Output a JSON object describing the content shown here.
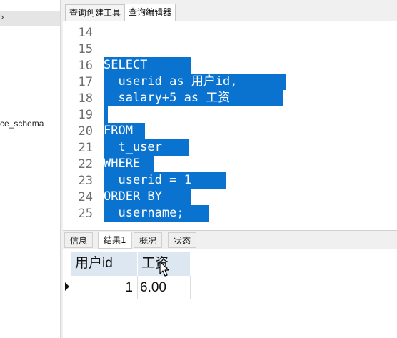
{
  "navigator": {
    "schema_item": "ce_schema",
    "selected_marker": "›"
  },
  "editor_tabs": [
    {
      "label": "查询创建工具",
      "active": false
    },
    {
      "label": "查询编辑器",
      "active": true
    }
  ],
  "editor": {
    "lines": [
      {
        "no": "14",
        "text": ""
      },
      {
        "no": "15",
        "text": ""
      },
      {
        "no": "16",
        "text": "SELECT"
      },
      {
        "no": "17",
        "text": "  userid as 用户id,"
      },
      {
        "no": "18",
        "text": "  salary+5 as 工资"
      },
      {
        "no": "19",
        "text": ""
      },
      {
        "no": "20",
        "text": "FROM"
      },
      {
        "no": "21",
        "text": "  t_user"
      },
      {
        "no": "22",
        "text": "WHERE"
      },
      {
        "no": "23",
        "text": "  userid = 1"
      },
      {
        "no": "24",
        "text": "ORDER BY"
      },
      {
        "no": "25",
        "text": "  username;"
      }
    ],
    "selection_color": "#0a73cf"
  },
  "result_tabs": [
    {
      "label": "信息",
      "active": false
    },
    {
      "label": "结果1",
      "active": true
    },
    {
      "label": "概况",
      "active": false
    },
    {
      "label": "状态",
      "active": false
    }
  ],
  "results": {
    "columns": [
      "用户id",
      "工资"
    ],
    "rows": [
      [
        "1",
        "6.00"
      ]
    ]
  }
}
